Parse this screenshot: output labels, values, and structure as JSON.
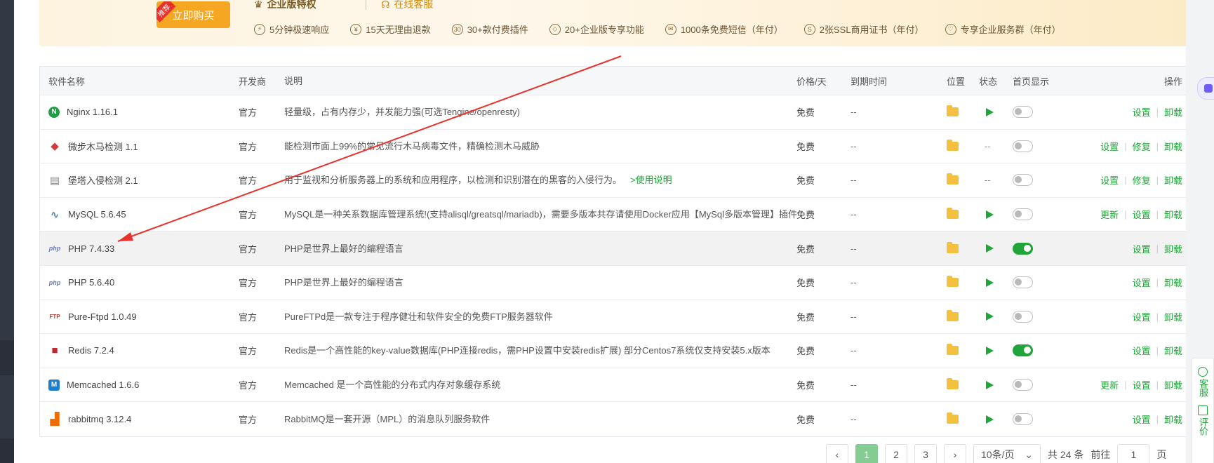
{
  "banner": {
    "buy_label": "立即购买",
    "buy_tag": "推荐",
    "enterprise_title": "企业版特权",
    "online_service": "在线客服",
    "perks": [
      {
        "icon": "lightning-icon",
        "glyph": "⚡",
        "label": "5分钟极速响应"
      },
      {
        "icon": "yen-icon",
        "glyph": "¥",
        "label": "15天无理由退款"
      },
      {
        "icon": "plugin-icon",
        "glyph": "30",
        "label": "30+款付费插件"
      },
      {
        "icon": "diamond-icon",
        "glyph": "◇",
        "label": "20+企业版专享功能"
      },
      {
        "icon": "mail-icon",
        "glyph": "✉",
        "label": "1000条免费短信（年付）"
      },
      {
        "icon": "ssl-icon",
        "glyph": "S",
        "label": "2张SSL商用证书（年付）"
      },
      {
        "icon": "heart-icon",
        "glyph": "♡",
        "label": "专享企业服务群（年付）"
      }
    ]
  },
  "table": {
    "headers": {
      "name": "软件名称",
      "dev": "开发商",
      "desc": "说明",
      "price": "价格/天",
      "expire": "到期时间",
      "location": "位置",
      "status": "状态",
      "home": "首页显示",
      "ops": "操作"
    },
    "rows": [
      {
        "name": "Nginx 1.16.1",
        "icon": "nginx-icon",
        "dev": "官方",
        "desc": "轻量级，占有内存少，并发能力强(可选Tengine/openresty)",
        "price": "免费",
        "expire": "--",
        "status": "play",
        "home": false,
        "ops": [
          "设置",
          "卸载"
        ]
      },
      {
        "name": "微步木马检测 1.1",
        "icon": "shield-icon",
        "dev": "官方",
        "desc": "能检测市面上99%的常见流行木马病毒文件，精确检测木马威胁",
        "price": "免费",
        "expire": "--",
        "status": "--",
        "home": false,
        "ops": [
          "设置",
          "修复",
          "卸载"
        ]
      },
      {
        "name": "堡塔入侵检测 2.1",
        "icon": "intrusion-icon",
        "dev": "官方",
        "desc": "用于监视和分析服务器上的系统和应用程序，以检测和识别潜在的黑客的入侵行为。",
        "desc_link": ">使用说明",
        "price": "免费",
        "expire": "--",
        "status": "--",
        "home": false,
        "ops": [
          "设置",
          "修复",
          "卸载"
        ]
      },
      {
        "name": "MySQL 5.6.45",
        "icon": "mysql-icon",
        "dev": "官方",
        "desc": "MySQL是一种关系数据库管理系统!(支持alisql/greatsql/mariadb)，需要多版本共存请使用Docker应用【MySql多版本管理】插件",
        "price": "免费",
        "expire": "--",
        "status": "play",
        "home": false,
        "ops": [
          "更新",
          "设置",
          "卸载"
        ]
      },
      {
        "name": "PHP 7.4.33",
        "icon": "php-icon",
        "dev": "官方",
        "desc": "PHP是世界上最好的编程语言",
        "price": "免费",
        "expire": "--",
        "status": "play",
        "home": true,
        "highlight": true,
        "ops": [
          "设置",
          "卸载"
        ]
      },
      {
        "name": "PHP 5.6.40",
        "icon": "php-icon",
        "dev": "官方",
        "desc": "PHP是世界上最好的编程语言",
        "price": "免费",
        "expire": "--",
        "status": "play",
        "home": false,
        "ops": [
          "设置",
          "卸载"
        ]
      },
      {
        "name": "Pure-Ftpd 1.0.49",
        "icon": "ftp-icon",
        "dev": "官方",
        "desc": "PureFTPd是一款专注于程序健壮和软件安全的免费FTP服务器软件",
        "price": "免费",
        "expire": "--",
        "status": "play",
        "home": false,
        "ops": [
          "设置",
          "卸载"
        ]
      },
      {
        "name": "Redis 7.2.4",
        "icon": "redis-icon",
        "dev": "官方",
        "desc": "Redis是一个高性能的key-value数据库(PHP连接redis，需PHP设置中安装redis扩展) 部分Centos7系统仅支持安装5.x版本",
        "price": "免费",
        "expire": "--",
        "status": "play",
        "home": true,
        "ops": [
          "设置",
          "卸载"
        ]
      },
      {
        "name": "Memcached 1.6.6",
        "icon": "memcached-icon",
        "dev": "官方",
        "desc": "Memcached 是一个高性能的分布式内存对象缓存系统",
        "price": "免费",
        "expire": "--",
        "status": "play",
        "home": false,
        "ops": [
          "更新",
          "设置",
          "卸载"
        ]
      },
      {
        "name": "rabbitmq 3.12.4",
        "icon": "rabbitmq-icon",
        "dev": "官方",
        "desc": "RabbitMQ是一套开源（MPL）的消息队列服务软件",
        "price": "免费",
        "expire": "--",
        "status": "play",
        "home": false,
        "ops": [
          "设置",
          "卸载"
        ]
      }
    ]
  },
  "pager": {
    "pages": [
      "1",
      "2",
      "3"
    ],
    "current": "1",
    "page_size": "10条/页",
    "total": "共 24 条",
    "goto_label": "前往",
    "goto_value": "1",
    "page_unit": "页"
  },
  "float_panel": {
    "service": "客服",
    "review": "评价"
  },
  "colors": {
    "accent": "#20a53a",
    "banner_button": "#f5a623",
    "annotation_arrow": "#e8322c"
  }
}
